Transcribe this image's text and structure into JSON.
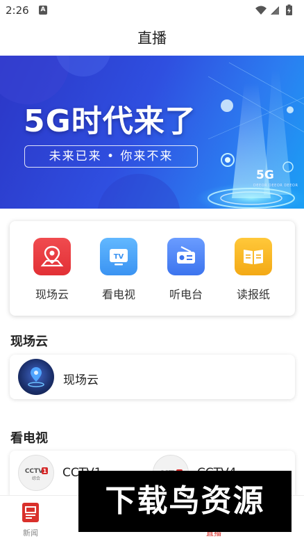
{
  "status_bar": {
    "time": "2:26",
    "notification_icon": "A"
  },
  "header": {
    "title": "直播"
  },
  "banner": {
    "headline": "5G时代来了",
    "subline": "未来已来 • 你来不来",
    "badge": "5G",
    "fine_print": "DEEOR DEEOR DEEOR"
  },
  "categories": [
    {
      "label": "现场云",
      "icon": "location-map-icon",
      "color": "#e8333a"
    },
    {
      "label": "看电视",
      "icon": "tv-icon",
      "color": "#3d9ff5"
    },
    {
      "label": "听电台",
      "icon": "radio-icon",
      "color": "#4a86f0"
    },
    {
      "label": "读报纸",
      "icon": "newspaper-icon",
      "color": "#f5b61e"
    }
  ],
  "sections": {
    "live_cloud": {
      "title": "现场云",
      "items": [
        {
          "label": "现场云"
        }
      ]
    },
    "tv": {
      "title": "看电视",
      "items": [
        {
          "label": "CCTV1",
          "logo_text": "CCTV1 综合"
        },
        {
          "label": "CCTV4",
          "logo_text": "CCTV4"
        }
      ]
    }
  },
  "tab_bar": {
    "tabs": [
      {
        "label": "新闻",
        "icon": "news-icon",
        "active": false
      },
      {
        "label": "",
        "icon": "",
        "active": false
      },
      {
        "label": "",
        "icon": "",
        "active": false
      },
      {
        "label": "直播",
        "icon": "live-icon",
        "active": true
      },
      {
        "label": "",
        "icon": "",
        "active": false
      }
    ]
  },
  "watermark": {
    "text": "下载鸟资源"
  },
  "colors": {
    "accent_red": "#d9302b",
    "banner_blue": "#2f4fe0"
  }
}
